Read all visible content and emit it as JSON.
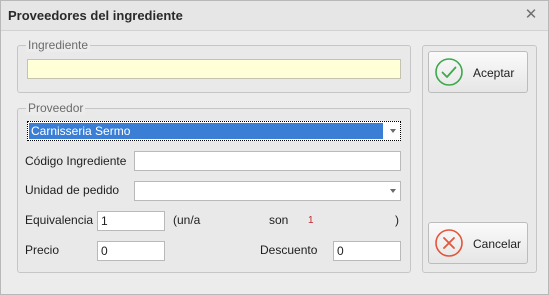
{
  "window": {
    "title": "Proveedores del ingrediente",
    "close_glyph": "✕"
  },
  "ingrediente_group": {
    "label": "Ingrediente",
    "value": ""
  },
  "proveedor_group": {
    "label": "Proveedor",
    "proveedor_selected": "Carnisseria Sermo",
    "codigo_label": "Código Ingrediente",
    "codigo_value": "",
    "unidad_label": "Unidad de pedido",
    "unidad_value": "",
    "equivalencia_label": "Equivalencia",
    "equivalencia_value": "1",
    "unit_prefix": "(un/a",
    "son_label": "son",
    "son_value": "1",
    "close_paren": ")",
    "precio_label": "Precio",
    "precio_value": "0",
    "descuento_label": "Descuento",
    "descuento_value": "0"
  },
  "buttons": {
    "accept_label": "Aceptar",
    "accept_icon": "checkmark-circle-icon",
    "cancel_label": "Cancelar",
    "cancel_icon": "x-circle-icon"
  },
  "colors": {
    "selection": "#3a7fd5",
    "required_field": "#ffffd8",
    "accept_icon": "#3ea84d",
    "cancel_icon": "#e4553b"
  }
}
